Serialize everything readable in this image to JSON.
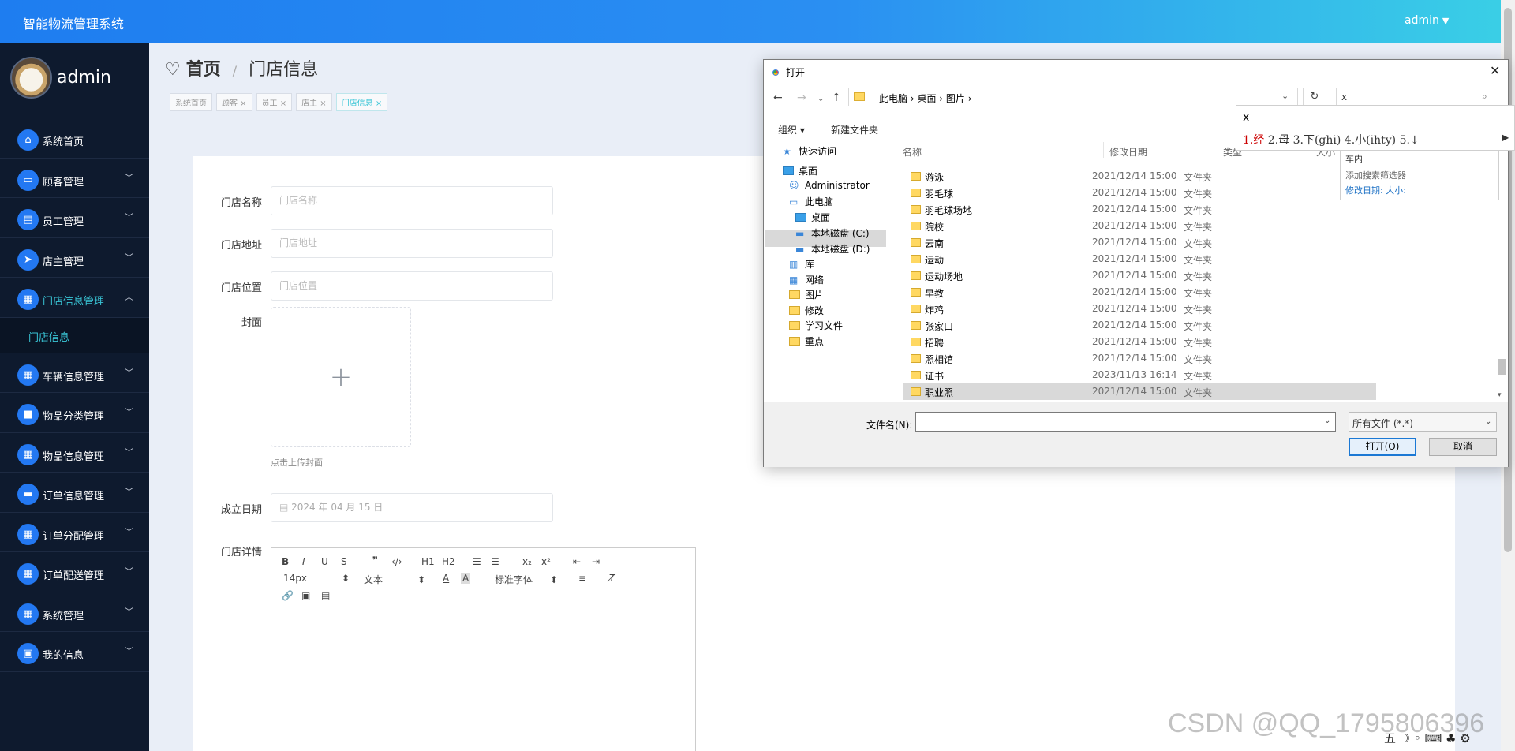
{
  "app": {
    "title": "智能物流管理系统",
    "user": "admin"
  },
  "sidebar": {
    "profile_name": "admin",
    "items": [
      {
        "label": "系统首页",
        "icon": "home-icon",
        "has_arrow": false
      },
      {
        "label": "顾客管理",
        "icon": "monitor-icon",
        "has_arrow": true
      },
      {
        "label": "员工管理",
        "icon": "clipboard-icon",
        "has_arrow": true
      },
      {
        "label": "店主管理",
        "icon": "send-icon",
        "has_arrow": true
      },
      {
        "label": "门店信息管理",
        "icon": "grid-icon",
        "has_arrow": true,
        "open": true
      },
      {
        "label": "车辆信息管理",
        "icon": "grid-icon",
        "has_arrow": true
      },
      {
        "label": "物品分类管理",
        "icon": "box-icon",
        "has_arrow": true
      },
      {
        "label": "物品信息管理",
        "icon": "grid-icon",
        "has_arrow": true
      },
      {
        "label": "订单信息管理",
        "icon": "ticket-icon",
        "has_arrow": true
      },
      {
        "label": "订单分配管理",
        "icon": "grid-icon",
        "has_arrow": true
      },
      {
        "label": "订单配送管理",
        "icon": "grid-icon",
        "has_arrow": true
      },
      {
        "label": "系统管理",
        "icon": "grid-icon",
        "has_arrow": true
      },
      {
        "label": "我的信息",
        "icon": "card-icon",
        "has_arrow": true
      }
    ],
    "submenu": "门店信息"
  },
  "breadcrumb": {
    "home": "首页",
    "sep": "/",
    "current": "门店信息"
  },
  "tags": [
    "系统首页",
    "顾客 ×",
    "员工 ×",
    "店主 ×",
    "门店信息 ×"
  ],
  "form": {
    "name_label": "门店名称",
    "name_placeholder": "门店名称",
    "address_label": "门店地址",
    "address_placeholder": "门店地址",
    "location_label": "门店位置",
    "location_placeholder": "门店位置",
    "cover_label": "封面",
    "cover_tip": "点击上传封面",
    "date_label": "成立日期",
    "date_value": "2024 年 04 月 15 日",
    "detail_label": "门店详情"
  },
  "editor_toolbar": {
    "font_size": "14px",
    "text_style": "文本",
    "font_family": "标准字体",
    "h1": "H1",
    "h2": "H2",
    "sub": "x₂",
    "sup": "x²"
  },
  "dialog": {
    "title": "打开",
    "path": [
      "此电脑",
      "桌面",
      "图片"
    ],
    "search_value": "x",
    "organize": "组织 ▾",
    "new_folder": "新建文件夹",
    "tree": [
      {
        "label": "快速访问",
        "kind": "star"
      },
      {
        "label": "桌面",
        "kind": "blue"
      },
      {
        "label": "Administrator",
        "kind": "user"
      },
      {
        "label": "此电脑",
        "kind": "pc"
      },
      {
        "label": "桌面",
        "kind": "blue",
        "selected": true
      },
      {
        "label": "本地磁盘 (C:)",
        "kind": "drive"
      },
      {
        "label": "本地磁盘 (D:)",
        "kind": "drive"
      },
      {
        "label": "库",
        "kind": "lib"
      },
      {
        "label": "网络",
        "kind": "net"
      },
      {
        "label": "图片",
        "kind": "folder"
      },
      {
        "label": "修改",
        "kind": "folder"
      },
      {
        "label": "学习文件",
        "kind": "folder"
      },
      {
        "label": "重点",
        "kind": "folder"
      }
    ],
    "columns": {
      "name": "名称",
      "date": "修改日期",
      "type": "类型",
      "size": "大小"
    },
    "files": [
      {
        "name": "游泳",
        "date": "2021/12/14 15:00",
        "type": "文件夹"
      },
      {
        "name": "羽毛球",
        "date": "2021/12/14 15:00",
        "type": "文件夹"
      },
      {
        "name": "羽毛球场地",
        "date": "2021/12/14 15:00",
        "type": "文件夹"
      },
      {
        "name": "院校",
        "date": "2021/12/14 15:00",
        "type": "文件夹"
      },
      {
        "name": "云南",
        "date": "2021/12/14 15:00",
        "type": "文件夹"
      },
      {
        "name": "运动",
        "date": "2021/12/14 15:00",
        "type": "文件夹"
      },
      {
        "name": "运动场地",
        "date": "2021/12/14 15:00",
        "type": "文件夹"
      },
      {
        "name": "早教",
        "date": "2021/12/14 15:00",
        "type": "文件夹"
      },
      {
        "name": "炸鸡",
        "date": "2021/12/14 15:00",
        "type": "文件夹"
      },
      {
        "name": "张家口",
        "date": "2021/12/14 15:00",
        "type": "文件夹"
      },
      {
        "name": "招聘",
        "date": "2021/12/14 15:00",
        "type": "文件夹"
      },
      {
        "name": "照相馆",
        "date": "2021/12/14 15:00",
        "type": "文件夹"
      },
      {
        "name": "证书",
        "date": "2023/11/13 16:14",
        "type": "文件夹"
      },
      {
        "name": "职业照",
        "date": "2021/12/14 15:00",
        "type": "文件夹",
        "selected": true
      }
    ],
    "filename_label": "文件名(N):",
    "filename_value": "",
    "filetype": "所有文件 (*.*)",
    "open_button": "打开(O)",
    "cancel_button": "取消"
  },
  "ime": {
    "composition": "x",
    "candidates_first": "1.经",
    "candidates_rest": "  2.母  3.下(ghi)  4.小(ihty)  5.↓"
  },
  "search_suggest": {
    "line1": "车内",
    "line2": "添加搜索筛选器",
    "line3": "修改日期:   大小:"
  },
  "watermark": "CSDN @QQ_1795806396",
  "tray": "五 ☽ ◦ ⌨ ♣ ⚙"
}
